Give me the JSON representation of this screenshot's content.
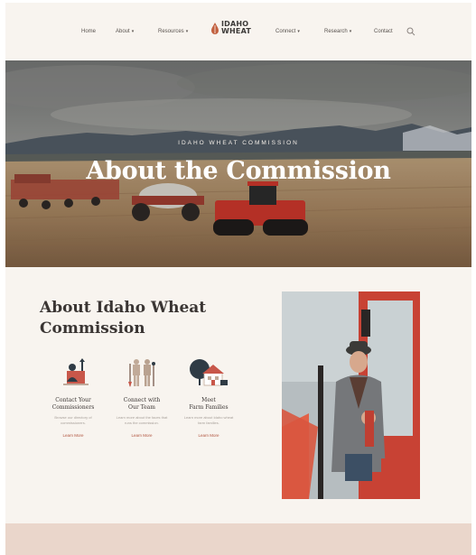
{
  "nav": {
    "items": [
      {
        "label": "Home",
        "dropdown": false
      },
      {
        "label": "About",
        "dropdown": true
      },
      {
        "label": "Resources",
        "dropdown": true
      },
      {
        "label": "Connect",
        "dropdown": true
      },
      {
        "label": "Research",
        "dropdown": true
      },
      {
        "label": "Contact",
        "dropdown": false
      }
    ],
    "logo_line1": "IDAHO",
    "logo_line2": "WHEAT",
    "search_icon": "search-icon"
  },
  "hero": {
    "eyebrow": "IDAHO WHEAT COMMISSION",
    "title": "About the Commission"
  },
  "about": {
    "title": "About Idaho Wheat Commission",
    "cards": [
      {
        "icon": "commissioner-icon",
        "title_line1": "Contact Your",
        "title_line2": "Commissioners",
        "desc": "Browse our directory of commissioners.",
        "link": "Learn More"
      },
      {
        "icon": "team-icon",
        "title_line1": "Connect with",
        "title_line2": "Our Team",
        "desc": "Learn more about the faces that runs the commission.",
        "link": "Learn More"
      },
      {
        "icon": "farm-house-icon",
        "title_line1": "Meet",
        "title_line2": "Farm Families",
        "desc": "Learn more about Idaho wheat farm families.",
        "link": "Learn More"
      }
    ]
  },
  "colors": {
    "background": "#f8f4ef",
    "accent": "#b0533d",
    "band": "#ead6cb",
    "text": "#3a3533"
  }
}
